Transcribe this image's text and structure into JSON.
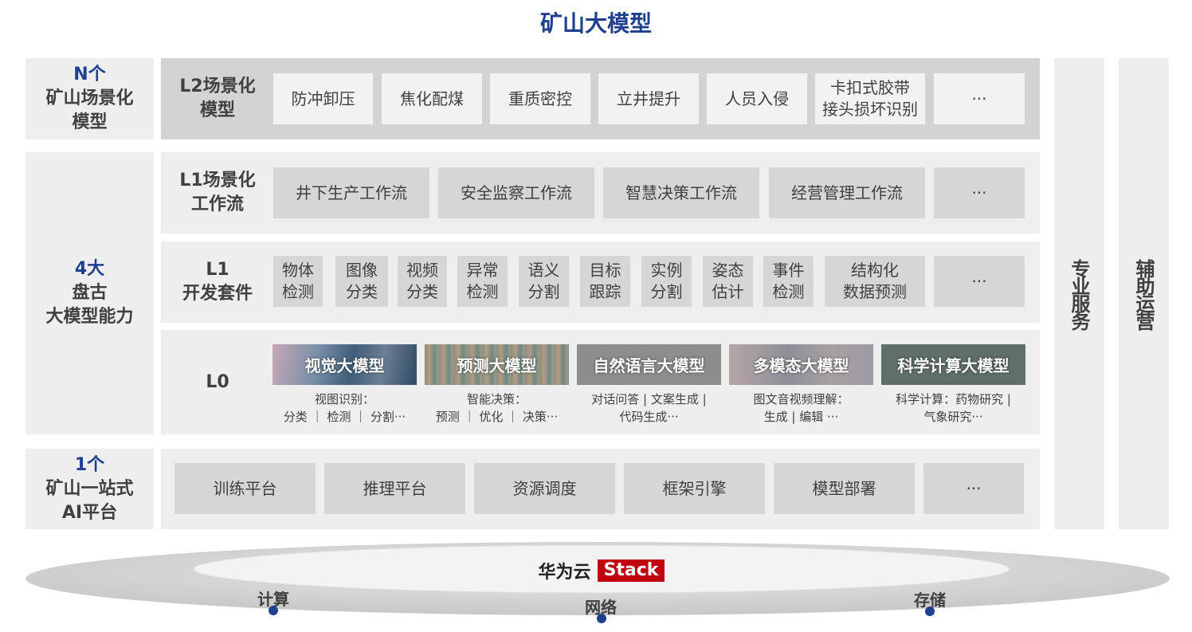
{
  "title": "矿山大模型",
  "left": {
    "n": {
      "highlight": "N个",
      "line1": "矿山场景化",
      "line2": "模型"
    },
    "four": {
      "highlight": "4大",
      "line1": "盘古",
      "line2": "大模型能力"
    },
    "one": {
      "highlight": "1个",
      "line1": "矿山一站式",
      "line2": "AI平台"
    }
  },
  "l2": {
    "label_line1": "L2场景化",
    "label_line2": "模型",
    "items": [
      {
        "label": "防冲卸压"
      },
      {
        "label": "焦化配煤"
      },
      {
        "label": "重质密控"
      },
      {
        "label": "立井提升"
      },
      {
        "label": "人员入侵"
      },
      {
        "label": "卡扣式胶带\n接头损坏识别"
      },
      {
        "label": "···"
      }
    ]
  },
  "l1wf": {
    "label_line1": "L1场景化",
    "label_line2": "工作流",
    "items": [
      {
        "label": "井下生产工作流"
      },
      {
        "label": "安全监察工作流"
      },
      {
        "label": "智慧决策工作流"
      },
      {
        "label": "经营管理工作流"
      },
      {
        "label": "···"
      }
    ]
  },
  "l1kit": {
    "label_line1": "L1",
    "label_line2": "开发套件",
    "items": [
      {
        "label": "物体\n检测"
      },
      {
        "label": "图像\n分类"
      },
      {
        "label": "视频\n分类"
      },
      {
        "label": "异常\n检测"
      },
      {
        "label": "语义\n分割"
      },
      {
        "label": "目标\n跟踪"
      },
      {
        "label": "实例\n分割"
      },
      {
        "label": "姿态\n估计"
      },
      {
        "label": "事件\n检测"
      },
      {
        "label": "结构化\n数据预测"
      },
      {
        "label": "···"
      }
    ]
  },
  "l0": {
    "label": "L0",
    "models": [
      {
        "name": "视觉大模型",
        "desc1": "视图识别：",
        "desc2": "分类 ｜ 检测 ｜ 分割···"
      },
      {
        "name": "预测大模型",
        "desc1": "智能决策：",
        "desc2": "预测 ｜ 优化 ｜ 决策···"
      },
      {
        "name": "自然语言大模型",
        "desc1": "对话问答 | 文案生成 |",
        "desc2": "代码生成···"
      },
      {
        "name": "多模态大模型",
        "desc1": "图文音视频理解：",
        "desc2": "生成 | 编辑 ···"
      },
      {
        "name": "科学计算大模型",
        "desc1": "科学计算：药物研究 |",
        "desc2": "气象研究···"
      }
    ]
  },
  "platform": {
    "items": [
      {
        "label": "训练平台"
      },
      {
        "label": "推理平台"
      },
      {
        "label": "资源调度"
      },
      {
        "label": "框架引擎"
      },
      {
        "label": "模型部署"
      },
      {
        "label": "···"
      }
    ]
  },
  "side": {
    "pro": "专业服务",
    "ops": "辅助运营"
  },
  "base": {
    "brand": "华为云",
    "stack": "Stack",
    "compute": "计算",
    "network": "网络",
    "storage": "存储"
  }
}
